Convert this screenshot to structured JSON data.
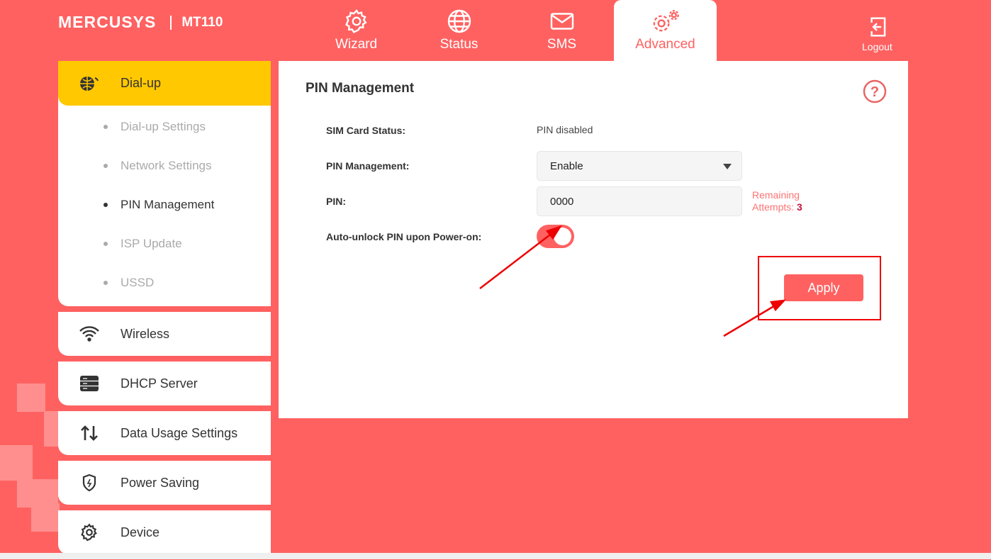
{
  "header": {
    "brand": "MERCUSYS",
    "model": "MT110",
    "logout": "Logout",
    "tabs": [
      {
        "label": "Wizard",
        "icon": "gear-icon"
      },
      {
        "label": "Status",
        "icon": "globe-icon"
      },
      {
        "label": "SMS",
        "icon": "envelope-icon"
      },
      {
        "label": "Advanced",
        "icon": "gears-icon",
        "active": true
      }
    ]
  },
  "sidebar": {
    "dialup": "Dial-up",
    "sub": [
      "Dial-up Settings",
      "Network Settings",
      "PIN Management",
      "ISP Update",
      "USSD"
    ],
    "items": [
      "Wireless",
      "DHCP Server",
      "Data Usage Settings",
      "Power Saving",
      "Device"
    ]
  },
  "main": {
    "title": "PIN Management",
    "sim_label": "SIM Card Status:",
    "sim_value": "PIN disabled",
    "pin_mgmt_label": "PIN Management:",
    "pin_mgmt_value": "Enable",
    "pin_label": "PIN:",
    "pin_value": "0000",
    "remaining_label": "Remaining",
    "attempts_label": "Attempts:",
    "attempts": "3",
    "auto_label": "Auto-unlock PIN upon Power-on:",
    "auto_on": true,
    "apply": "Apply"
  },
  "colors": {
    "brand": "#ff6161",
    "active_menu": "#ffc800"
  }
}
